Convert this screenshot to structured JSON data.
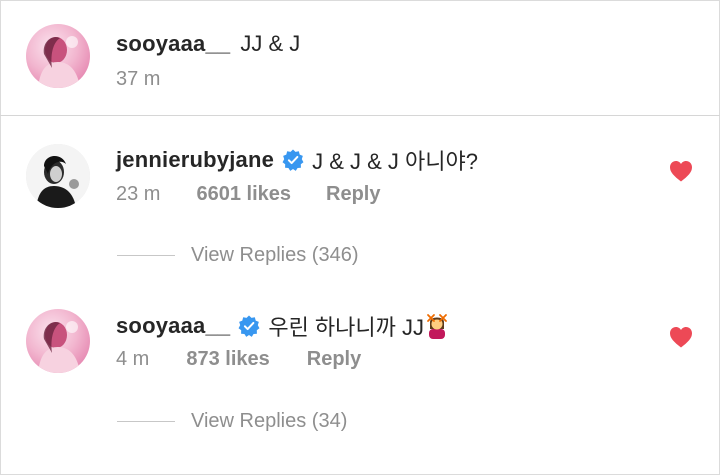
{
  "caption": {
    "username": "sooyaaa__",
    "text": "JJ & J",
    "time": "37 m"
  },
  "comments": [
    {
      "username": "jennierubyjane",
      "verified": true,
      "text": "J & J & J 아니야?",
      "time": "23 m",
      "likes": "6601 likes",
      "reply_label": "Reply",
      "liked": true,
      "view_replies": "View Replies (346)"
    },
    {
      "username": "sooyaaa__",
      "verified": true,
      "text": "우린 하나니까 JJ",
      "emoji": "woman-gesturing-no-emoji",
      "time": "4 m",
      "likes": "873 likes",
      "reply_label": "Reply",
      "liked": true,
      "view_replies": "View Replies (34)"
    }
  ],
  "colors": {
    "heart": "#ed4956",
    "verified": "#3897f0",
    "secondary_text": "#8e8e8e",
    "primary_text": "#262626"
  },
  "icons": {
    "verified": "verified-badge-icon",
    "like": "heart-icon"
  }
}
